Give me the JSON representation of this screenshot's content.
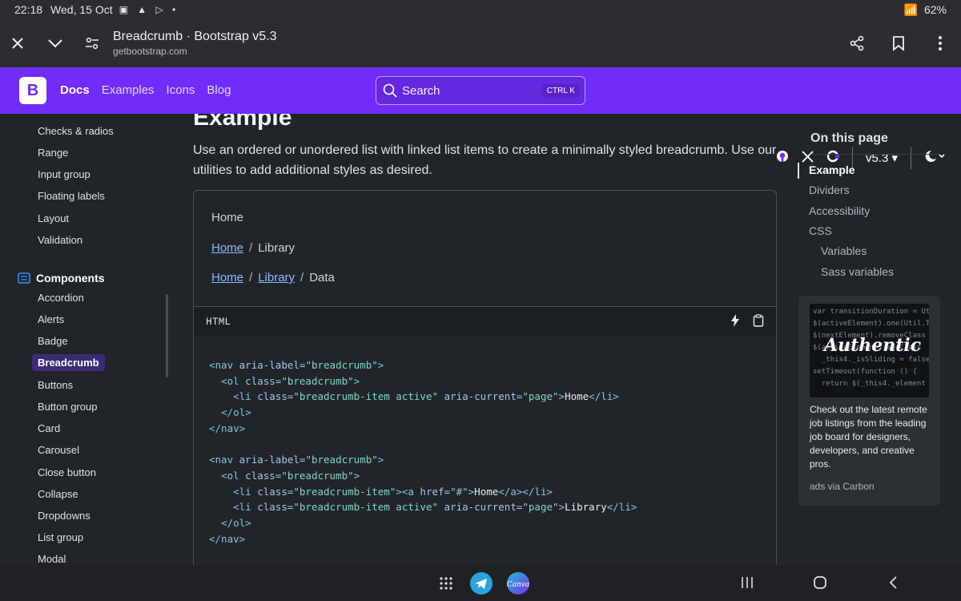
{
  "status": {
    "time": "22:18",
    "date": "Wed, 15 Oct",
    "battery": "62%"
  },
  "browser": {
    "title": "Breadcrumb · Bootstrap v5.3",
    "url": "getbootstrap.com"
  },
  "navbar": {
    "brand": "B",
    "links": [
      "Docs",
      "Examples",
      "Icons",
      "Blog"
    ],
    "search": "Search",
    "kbd": "CTRL K",
    "version": "v5.3"
  },
  "sidebar": {
    "forms_items": [
      "Checks & radios",
      "Range",
      "Input group",
      "Floating labels",
      "Layout",
      "Validation"
    ],
    "section": "Components",
    "components": [
      "Accordion",
      "Alerts",
      "Badge",
      "Breadcrumb",
      "Buttons",
      "Button group",
      "Card",
      "Carousel",
      "Close button",
      "Collapse",
      "Dropdowns",
      "List group",
      "Modal"
    ],
    "active": "Breadcrumb"
  },
  "main": {
    "heading": "Example",
    "lead": "Use an ordered or unordered list with linked list items to create a minimally styled breadcrumb. Use our utilities to add additional styles as desired.",
    "crumbs": {
      "home": "Home",
      "library": "Library",
      "data": "Data",
      "sep": "/"
    },
    "code_label": "HTML"
  },
  "toc": {
    "title": "On this page",
    "items": [
      "Example",
      "Dividers",
      "Accessibility",
      "CSS",
      "Variables",
      "Sass variables"
    ]
  },
  "ad": {
    "text": "Check out the latest remote job listings from the leading job board for designers, developers, and creative pros.",
    "credit": "ads via Carbon",
    "image_word": "Authentic"
  },
  "colors": {
    "brand": "#712cf9",
    "bg": "#212529",
    "link": "#8bb9fe"
  }
}
